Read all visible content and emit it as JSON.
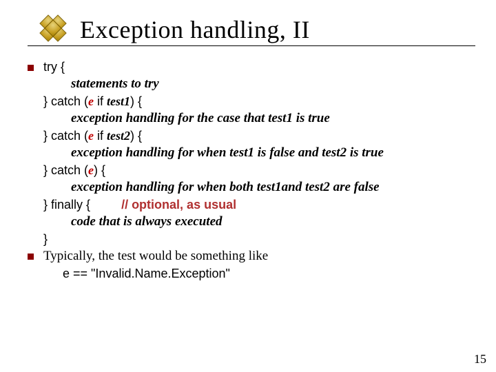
{
  "header": {
    "title": "Exception handling, II",
    "icon_name": "diamond-cluster-icon"
  },
  "body": {
    "b1": {
      "l1a": "try {",
      "l2": "statements to try",
      "l3a": "} catch (",
      "l3b": "e",
      "l3c": " if ",
      "l3d": "test1",
      "l3e": ") {",
      "l4": "exception handling for the case that test1 is true",
      "l5a": "} catch (",
      "l5b": "e",
      "l5c": " if ",
      "l5d": "test2",
      "l5e": ") {",
      "l6": "exception handling for when test1 is false and test2 is true",
      "l7a": "} catch (",
      "l7b": "e",
      "l7c": ") {",
      "l8": "exception handling for when both test1and test2 are false",
      "l9a": "} finally {",
      "l9b": "// optional, as usual",
      "l10": "code that is always executed",
      "l11": "}"
    },
    "b2": {
      "line1": "Typically, the test would be something like",
      "line2": "e == \"Invalid.Name.Exception\""
    }
  },
  "footer": {
    "pagenum": "15"
  }
}
